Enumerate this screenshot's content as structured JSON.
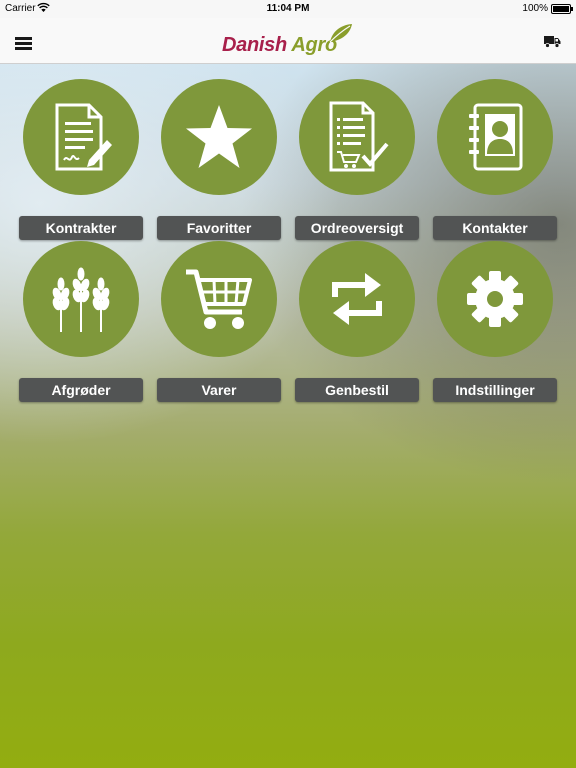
{
  "status_bar": {
    "carrier": "Carrier",
    "time": "11:04 PM",
    "battery": "100%"
  },
  "nav": {
    "logo_word1": "Danish",
    "logo_word2": "Agro",
    "menu_icon": "hamburger-menu-icon",
    "right_icon": "truck-icon"
  },
  "tiles": [
    {
      "label": "Kontrakter",
      "icon": "contract-icon"
    },
    {
      "label": "Favoritter",
      "icon": "star-icon"
    },
    {
      "label": "Ordreoversigt",
      "icon": "order-overview-icon"
    },
    {
      "label": "Kontakter",
      "icon": "contacts-book-icon"
    },
    {
      "label": "Afgrøder",
      "icon": "wheat-icon"
    },
    {
      "label": "Varer",
      "icon": "shopping-cart-icon"
    },
    {
      "label": "Genbestil",
      "icon": "reorder-arrows-icon"
    },
    {
      "label": "Indstillinger",
      "icon": "gear-icon"
    }
  ],
  "colors": {
    "brand_red": "#a8204b",
    "brand_green": "#8a9e2b",
    "tile_circle": "#7f983b",
    "tile_label_bg": "#525454"
  }
}
